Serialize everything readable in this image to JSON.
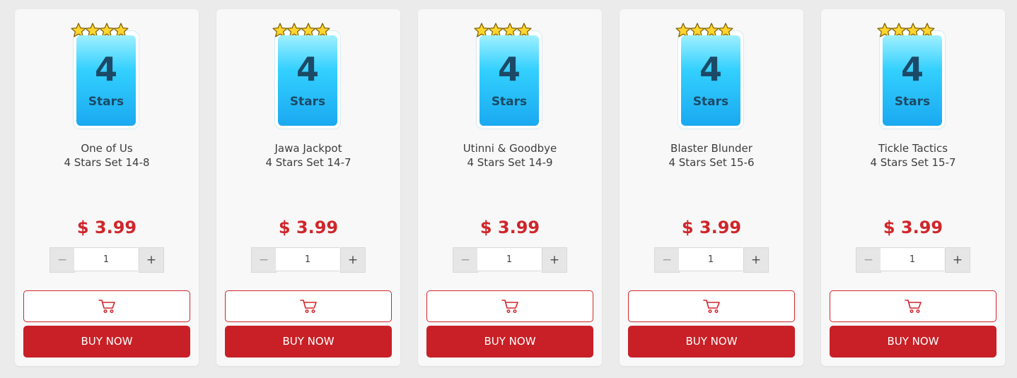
{
  "products": [
    {
      "badge_number": "4",
      "badge_label": "Stars",
      "rating": 4,
      "name": "One of Us",
      "subtitle": "4 Stars Set 14-8",
      "price": "$ 3.99",
      "quantity": "1",
      "minus": "−",
      "plus": "+",
      "buy_label": "BUY NOW"
    },
    {
      "badge_number": "4",
      "badge_label": "Stars",
      "rating": 4,
      "name": "Jawa Jackpot",
      "subtitle": "4 Stars Set 14-7",
      "price": "$ 3.99",
      "quantity": "1",
      "minus": "−",
      "plus": "+",
      "buy_label": "BUY NOW"
    },
    {
      "badge_number": "4",
      "badge_label": "Stars",
      "rating": 4,
      "name": "Utinni & Goodbye",
      "subtitle": "4 Stars Set 14-9",
      "price": "$ 3.99",
      "quantity": "1",
      "minus": "−",
      "plus": "+",
      "buy_label": "BUY NOW"
    },
    {
      "badge_number": "4",
      "badge_label": "Stars",
      "rating": 4,
      "name": "Blaster Blunder",
      "subtitle": "4 Stars Set 15-6",
      "price": "$ 3.99",
      "quantity": "1",
      "minus": "−",
      "plus": "+",
      "buy_label": "BUY NOW"
    },
    {
      "badge_number": "4",
      "badge_label": "Stars",
      "rating": 4,
      "name": "Tickle Tactics",
      "subtitle": "4 Stars Set 15-7",
      "price": "$ 3.99",
      "quantity": "1",
      "minus": "−",
      "plus": "+",
      "buy_label": "BUY NOW"
    }
  ],
  "icons": {
    "cart": "shopping-cart-icon",
    "star": "star-icon"
  },
  "colors": {
    "accent": "#c82026",
    "price": "#d0262b",
    "badge_top": "#9ff0ff",
    "badge_bottom": "#1aa9f0",
    "star": "#ffd52e"
  }
}
